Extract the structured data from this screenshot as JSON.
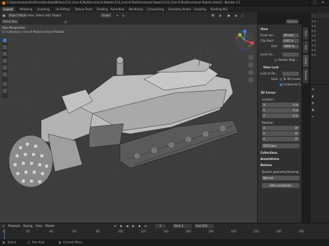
{
  "window": {
    "title": "C:\\Users\\mahje\\OneDrive\\Desktop\\Military\\114_Uran-6 Multifunctional Robotic\\114_Uran-6 Multifunctional Robotic\\114_Uran-6 Multifunctional Robotic.blend] - Blender 4.1",
    "min_icon": "minimize-icon",
    "max_icon": "maximize-icon",
    "close_icon": "close-icon"
  },
  "workspaces": [
    "Layout",
    "Modeling",
    "Sculpting",
    "UV Editing",
    "Texture Paint",
    "Shading",
    "Animation",
    "Rendering",
    "Compositing",
    "Geometry Nodes",
    "Scripting",
    "Shading.001"
  ],
  "active_workspace": "Layout",
  "viewport_header": {
    "mode": "Object Mode",
    "menus": [
      "View",
      "Select",
      "Add",
      "Object"
    ],
    "orientation": "Global",
    "select_box": "Select Box",
    "options": "Options"
  },
  "viewport_overlay": {
    "view_name": "User Perspective",
    "collection": "(1) Collection | Uran-6 Multifunctional Robotic"
  },
  "npanel": {
    "view_header": "View",
    "focal_label": "Focal Len...",
    "focal_value": "50 mm",
    "clip_start_label": "Clip Start",
    "clip_start_value": "0.01 m",
    "end_label": "End",
    "end_value": "1000 m",
    "local_cam_label": "Local Ca...",
    "render_region": "Render Regi...",
    "view_lock_header": "View Lock",
    "lock_obj_label": "Lock to Ob...",
    "lock_label": "Lock",
    "to3d_cursor": "To 3D Cursor",
    "camera_to_view": "Camera to V...",
    "cursor_header": "3D Cursor",
    "location_label": "Location:",
    "loc_x_label": "X",
    "loc_x_value": "0 m",
    "loc_y_label": "Y",
    "loc_y_value": "0 m",
    "loc_z_label": "Z",
    "loc_z_value": "0 m",
    "rotation_label": "Rotation:",
    "rot_x_label": "X",
    "rot_x_value": "0°",
    "rot_y_label": "Y",
    "rot_y_value": "0°",
    "rot_z_label": "Z",
    "rot_z_value": "0°",
    "euler_mode": "XYZ Euler",
    "collections_header": "Collections",
    "annotations_header": "Annotations",
    "batoms_header": "Batoms",
    "geometry_label": "Quarter geometry/drawing",
    "batoms_item": "Not set",
    "batoms_btn": "Add coordinates"
  },
  "vertical_tabs": [
    "Item",
    "Tool",
    "View",
    "Batoms"
  ],
  "timeline": {
    "menus": [
      "Playback",
      "Keying",
      "View",
      "Marker"
    ],
    "ticks": [
      "0",
      "20",
      "40",
      "60",
      "80",
      "100",
      "120",
      "140",
      "160",
      "180",
      "200",
      "220",
      "240",
      "260"
    ],
    "current_frame": "1",
    "start_label": "Start",
    "start_value": "1",
    "end_label": "End",
    "end_value": "250"
  },
  "statusbar": {
    "select": "Select",
    "pan": "Pan View",
    "context": "Context Menu"
  }
}
